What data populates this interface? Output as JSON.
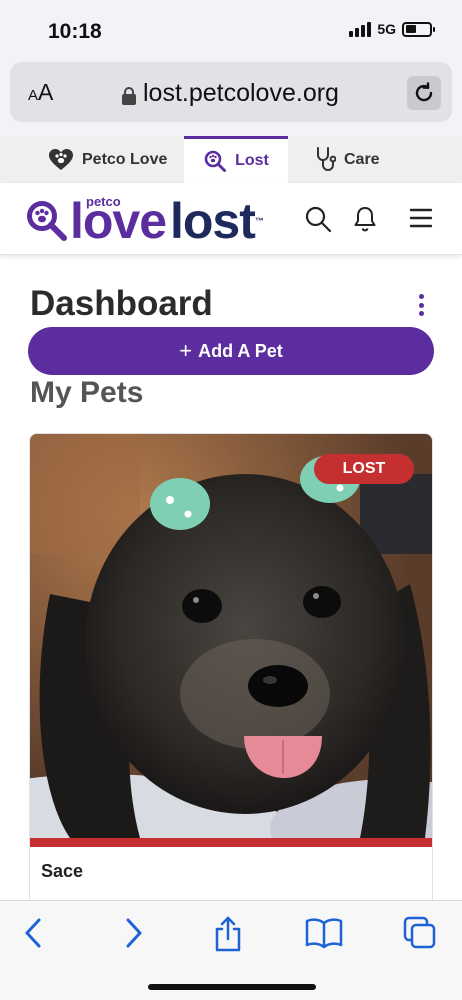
{
  "status_bar": {
    "time": "10:18",
    "network": "5G",
    "battery_level": 0.45
  },
  "browser": {
    "text_size_label_small": "A",
    "text_size_label_large": "A",
    "url": "lost.petcolove.org"
  },
  "site_tabs": [
    {
      "label": "Petco Love",
      "icon": "heart-paw-icon"
    },
    {
      "label": "Lost",
      "icon": "magnifier-paw-icon",
      "active": true
    },
    {
      "label": "Care",
      "icon": "stethoscope-icon"
    }
  ],
  "brand": {
    "small": "petco",
    "love": "love",
    "lost": "lost",
    "tm": "™"
  },
  "dashboard": {
    "title": "Dashboard",
    "add_pet_plus": "+",
    "add_pet_label": "Add A Pet",
    "section_title": "My Pets"
  },
  "pet": {
    "badge": "LOST",
    "name": "Sace",
    "status_color": "#c62f2f"
  },
  "colors": {
    "brand_purple": "#5b2d9e",
    "brand_navy": "#1f2a5c",
    "lost_red": "#c62f2f",
    "ios_blue": "#1e63d6"
  },
  "toolbar": [
    "back-icon",
    "forward-icon",
    "share-icon",
    "bookmarks-icon",
    "tabs-icon"
  ]
}
